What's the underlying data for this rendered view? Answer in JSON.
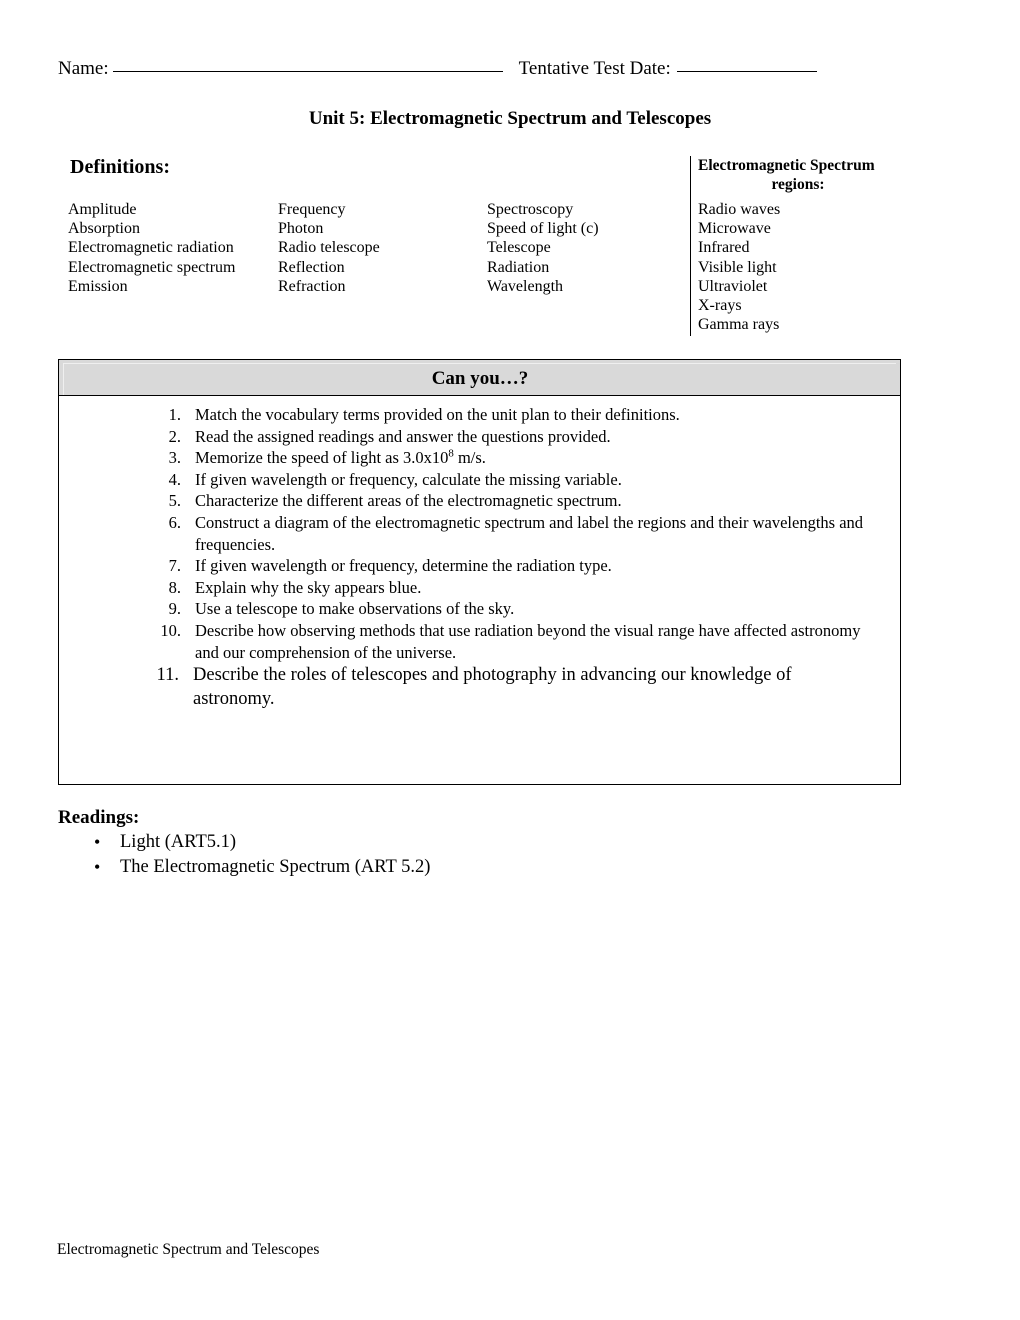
{
  "header": {
    "name_label": "Name:",
    "date_label": "Tentative Test Date:",
    "unit_title": "Unit 5:  Electromagnetic Spectrum and Telescopes"
  },
  "definitions": {
    "heading": "Definitions:",
    "columns": [
      [
        "Amplitude",
        "Absorption",
        "Electromagnetic radiation",
        "Electromagnetic spectrum",
        "Emission"
      ],
      [
        "Frequency",
        "Photon",
        "Radio telescope",
        "Reflection",
        "Refraction"
      ],
      [
        "Spectroscopy",
        "Speed of light (c)",
        "Telescope",
        "Radiation",
        "Wavelength"
      ]
    ]
  },
  "em_regions": {
    "heading_line1": "Electromagnetic Spectrum",
    "heading_line2": "regions:",
    "items": [
      "Radio waves",
      "Microwave",
      "Infrared",
      "Visible light",
      "Ultraviolet",
      "X-rays",
      "Gamma rays"
    ]
  },
  "can_you": {
    "title": "Can you…?",
    "header_bg": "#d9d9d9",
    "tasks": [
      {
        "num": "1.",
        "text": "Match the vocabulary terms provided on the unit plan to their definitions."
      },
      {
        "num": "2.",
        "text": "Read the assigned readings and answer the questions provided."
      },
      {
        "num": "3.",
        "text_before": "Memorize the speed of light as 3.0x10",
        "superscript": "8",
        "text_after": " m/s."
      },
      {
        "num": "4.",
        "text": "If given wavelength or frequency, calculate the missing variable."
      },
      {
        "num": "5.",
        "text": "Characterize the different areas of the electromagnetic spectrum."
      },
      {
        "num": "6.",
        "text": "Construct a diagram of the electromagnetic spectrum and label the regions and their wavelengths and frequencies."
      },
      {
        "num": "7.",
        "text": "If given wavelength or frequency, determine the radiation type."
      },
      {
        "num": "8.",
        "text": "Explain why the sky appears blue."
      },
      {
        "num": "9.",
        "text": "Use a telescope to make observations of the sky."
      },
      {
        "num": "10.",
        "text": "Describe how observing methods that use radiation beyond the visual range have affected astronomy and our comprehension of the universe."
      },
      {
        "num": "11.",
        "text": "Describe the roles of telescopes and photography in advancing our knowledge of astronomy."
      }
    ]
  },
  "readings": {
    "heading": "Readings:",
    "bullet_glyph": "•",
    "items": [
      "Light (ART5.1)",
      "The Electromagnetic Spectrum (ART 5.2)"
    ]
  },
  "footer": {
    "text": "Electromagnetic Spectrum and Telescopes"
  }
}
